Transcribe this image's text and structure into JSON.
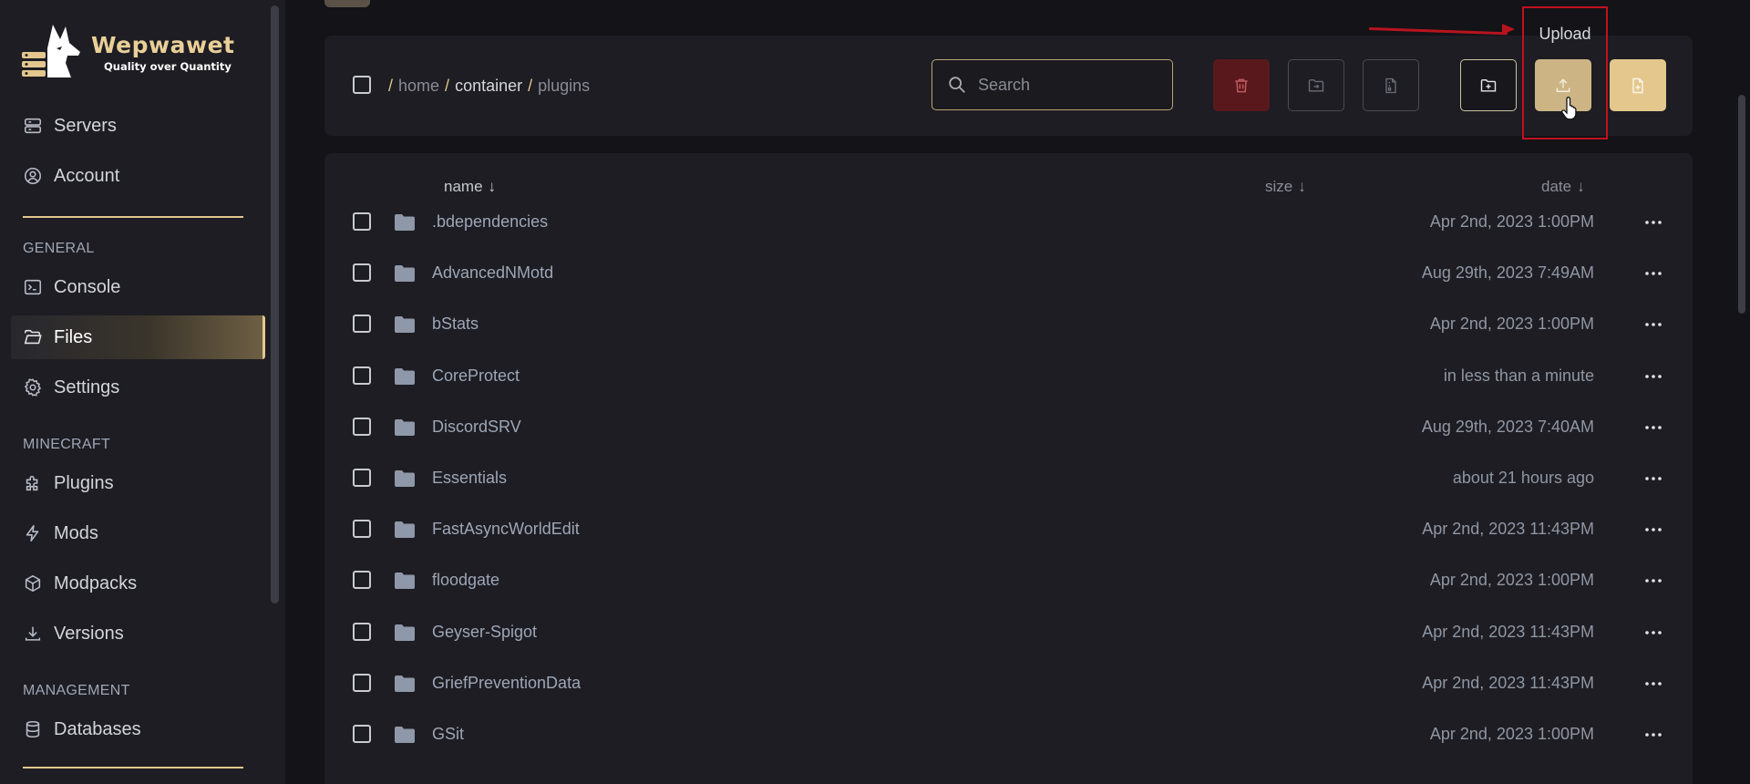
{
  "brand": {
    "title": "Wepwawet",
    "subtitle": "Quality over Quantity"
  },
  "sidebar": {
    "items_top": [
      {
        "label": "Servers",
        "icon": "server-icon"
      },
      {
        "label": "Account",
        "icon": "user-circle-icon"
      }
    ],
    "sections": [
      {
        "title": "GENERAL",
        "items": [
          {
            "label": "Console",
            "icon": "terminal-icon"
          },
          {
            "label": "Files",
            "icon": "folder-open-icon",
            "active": true
          },
          {
            "label": "Settings",
            "icon": "gear-icon"
          }
        ]
      },
      {
        "title": "MINECRAFT",
        "items": [
          {
            "label": "Plugins",
            "icon": "puzzle-icon"
          },
          {
            "label": "Mods",
            "icon": "bolt-icon"
          },
          {
            "label": "Modpacks",
            "icon": "cube-icon"
          },
          {
            "label": "Versions",
            "icon": "download-icon"
          }
        ]
      },
      {
        "title": "MANAGEMENT",
        "items": [
          {
            "label": "Databases",
            "icon": "database-icon"
          }
        ]
      }
    ]
  },
  "toolbar": {
    "breadcrumb": [
      "home",
      "container",
      "plugins"
    ],
    "search_placeholder": "Search",
    "search_value": "",
    "buttons": [
      "delete",
      "move",
      "archive",
      "new-folder",
      "upload",
      "new-file"
    ],
    "tooltip": "Upload"
  },
  "filelist": {
    "columns": {
      "name": "name",
      "size": "size",
      "date": "date"
    },
    "sort_arrow": "↓",
    "rows": [
      {
        "name": ".bdependencies",
        "date": "Apr 2nd, 2023 1:00PM"
      },
      {
        "name": "AdvancedNMotd",
        "date": "Aug 29th, 2023 7:49AM"
      },
      {
        "name": "bStats",
        "date": "Apr 2nd, 2023 1:00PM"
      },
      {
        "name": "CoreProtect",
        "date": "in less than a minute"
      },
      {
        "name": "DiscordSRV",
        "date": "Aug 29th, 2023 7:40AM"
      },
      {
        "name": "Essentials",
        "date": "about 21 hours ago"
      },
      {
        "name": "FastAsyncWorldEdit",
        "date": "Apr 2nd, 2023 11:43PM"
      },
      {
        "name": "floodgate",
        "date": "Apr 2nd, 2023 1:00PM"
      },
      {
        "name": "Geyser-Spigot",
        "date": "Apr 2nd, 2023 11:43PM"
      },
      {
        "name": "GriefPreventionData",
        "date": "Apr 2nd, 2023 11:43PM"
      },
      {
        "name": "GSit",
        "date": "Apr 2nd, 2023 1:00PM"
      }
    ]
  },
  "colors": {
    "accent": "#e3c78d",
    "background": "#131318",
    "panel": "#1d1d23",
    "danger": "#59191c",
    "annotation": "#c1111d"
  }
}
